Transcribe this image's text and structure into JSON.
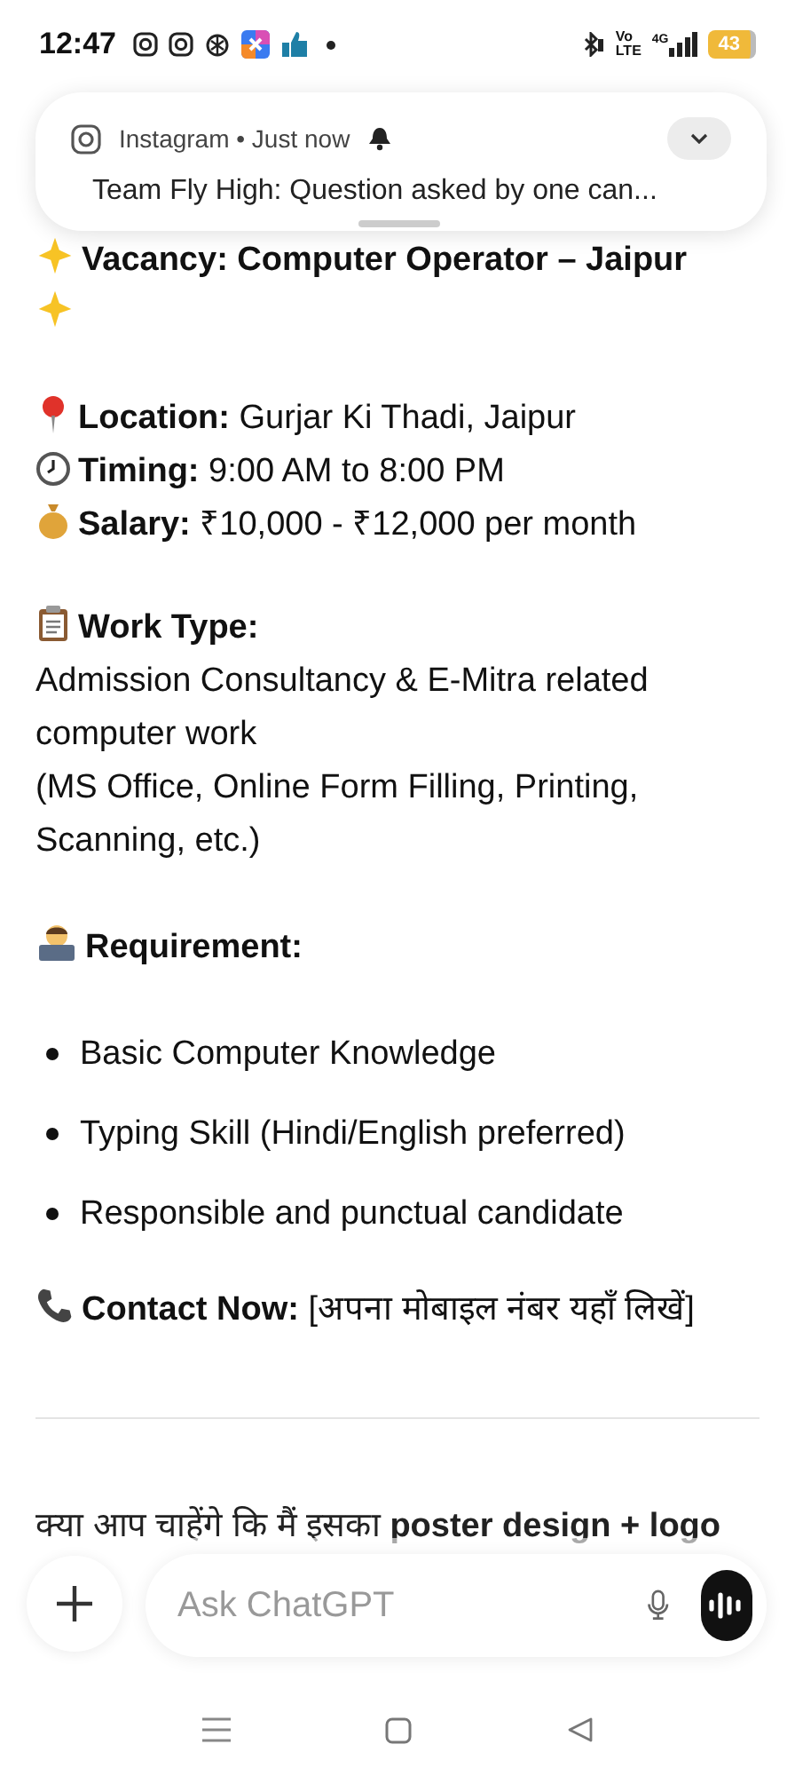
{
  "status_bar": {
    "time": "12:47",
    "network_top": "Vo",
    "network_bottom": "LTE",
    "data_type": "4G",
    "battery": "43"
  },
  "notification": {
    "app": "Instagram • Just now",
    "message": "Team Fly High: Question asked by one can..."
  },
  "message": {
    "title": "Vacancy: Computer Operator – Jaipur",
    "details": [
      {
        "kind": "pin",
        "text": "**Location:** Gurjar Ki Thadi, Jaipur"
      },
      {
        "kind": "clock",
        "text": "**Timing:** 9:00 AM to 8:00 PM"
      },
      {
        "kind": "money",
        "text": "**Salary:** ₹10,000 - ₹12,000 per month"
      }
    ],
    "work_type": {
      "heading": "Work Type:",
      "lines": [
        "Admission Consultancy & E-Mitra related computer work",
        "(MS Office, Online Form Filling, Printing, Scanning, etc.)"
      ]
    },
    "requirement": {
      "heading": "Requirement:",
      "bullets": [
        "Basic Computer Knowledge",
        "Typing Skill (Hindi/English preferred)",
        "Responsible and punctual candidate"
      ]
    },
    "contact": "**Contact Now:** [अपना मोबाइल नंबर यहाँ लिखें]",
    "follow_up": "क्या आप चाहेंगे कि मैं इसका **poster design + logo**"
  },
  "composer": {
    "placeholder": "Ask ChatGPT"
  }
}
